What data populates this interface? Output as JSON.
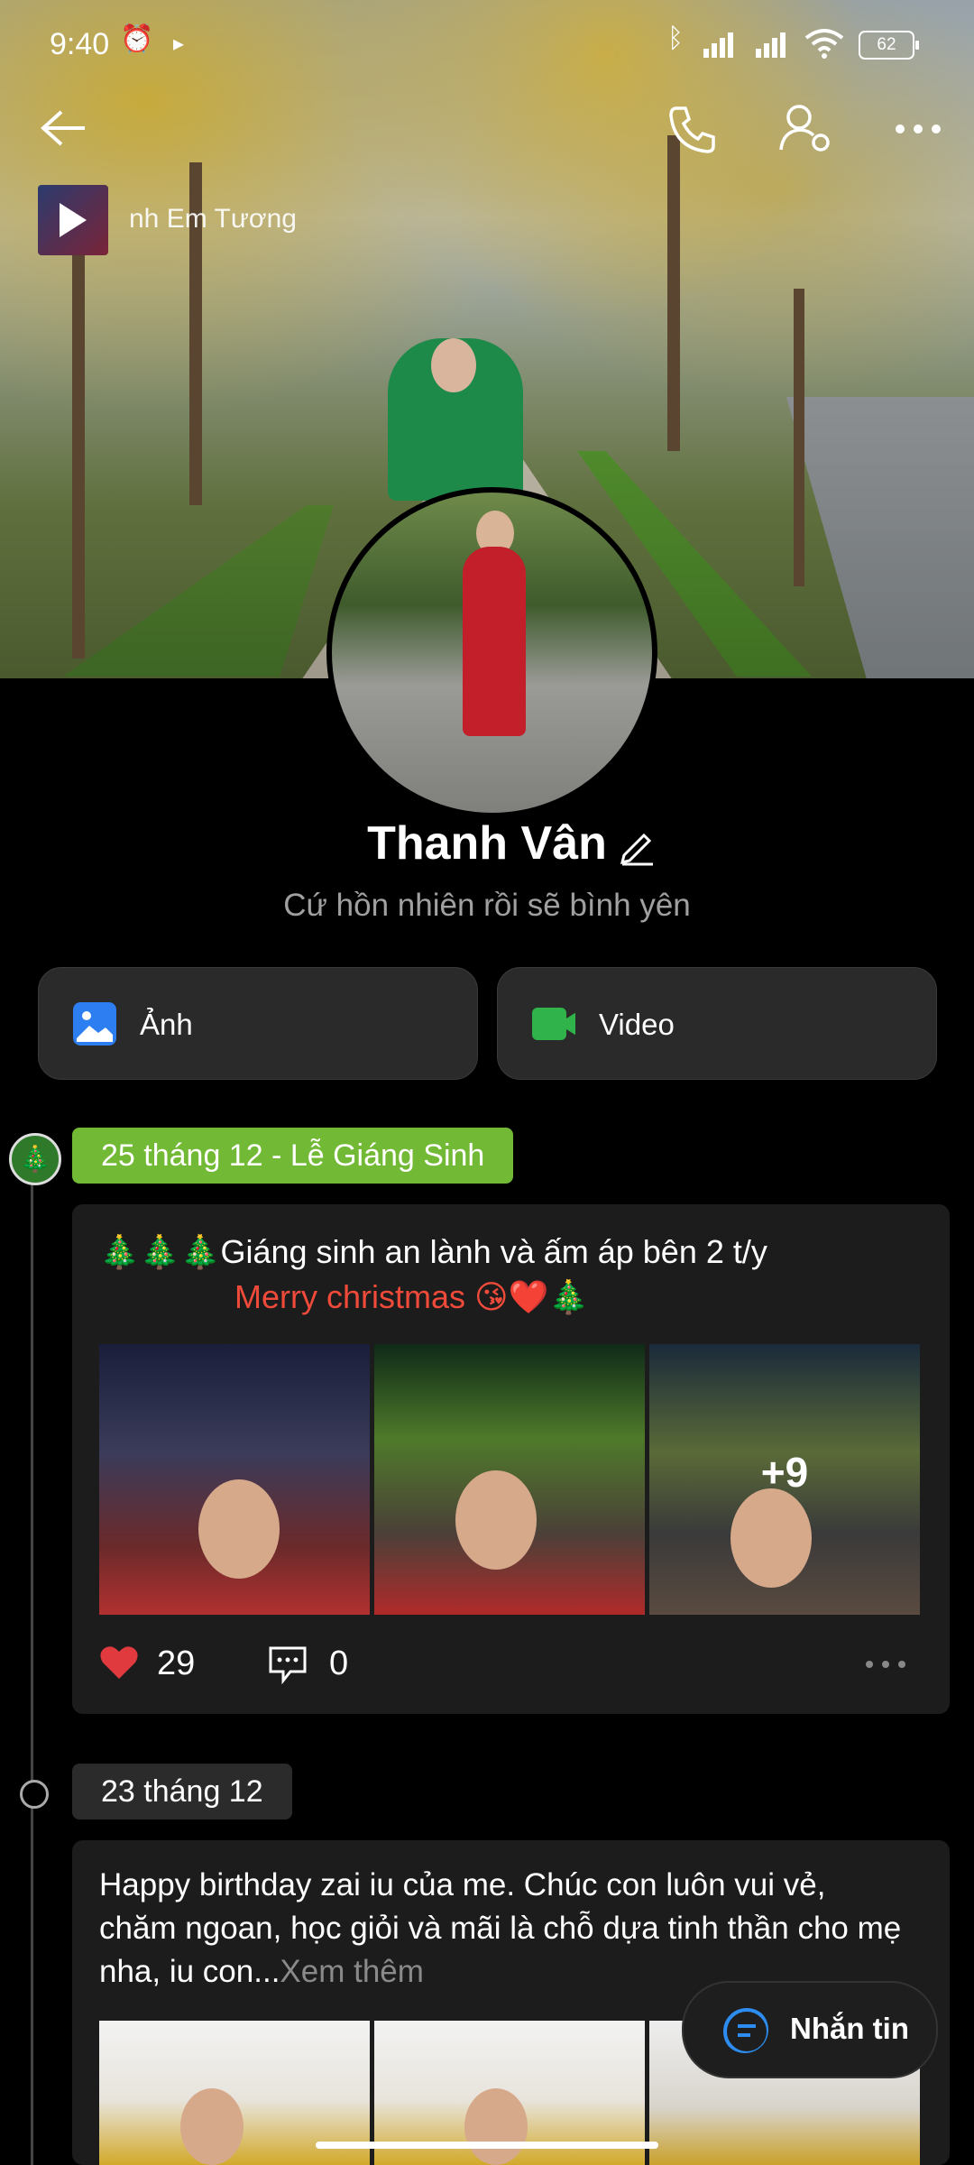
{
  "status_bar": {
    "time": "9:40",
    "battery": "62",
    "icons": [
      "alarm-icon",
      "location-arrow-icon",
      "bluetooth-icon",
      "signal-icon",
      "signal-icon",
      "wifi-icon",
      "battery-icon"
    ]
  },
  "header": {
    "music_title": "nh Em Tương",
    "icons": [
      "back-arrow-icon",
      "phone-icon",
      "user-settings-icon",
      "more-icon"
    ]
  },
  "profile": {
    "name": "Thanh Vân",
    "bio": "Cứ hồn nhiên rồi sẽ bình yên"
  },
  "tabs": [
    {
      "label": "Ảnh",
      "color": "#2d7ef0"
    },
    {
      "label": "Video",
      "color": "#2fb34a"
    }
  ],
  "timeline": {
    "groups": [
      {
        "date": "25 tháng 12 - Lễ Giáng Sinh",
        "post": {
          "text_line1": "🎄🎄🎄Giáng sinh an lành và ấm áp bên 2 t/y",
          "text_line2": "Merry christmas 😘❤️🎄",
          "more_photos": "+9",
          "likes": "29",
          "comments": "0"
        }
      },
      {
        "date": "23 tháng 12",
        "post": {
          "text": "Happy birthday zai iu của me. Chúc con luôn vui vẻ, chăm ngoan, học giỏi và mãi là chỗ dựa tinh thần cho mẹ nha, iu con...",
          "see_more": "Xem thêm"
        }
      }
    ]
  },
  "message_button": {
    "label": "Nhắn tin"
  },
  "colors": {
    "accent_green": "#72b935",
    "accent_blue": "#2d8cf0",
    "like_red": "#e0393e",
    "text_red": "#ef4a3a"
  }
}
